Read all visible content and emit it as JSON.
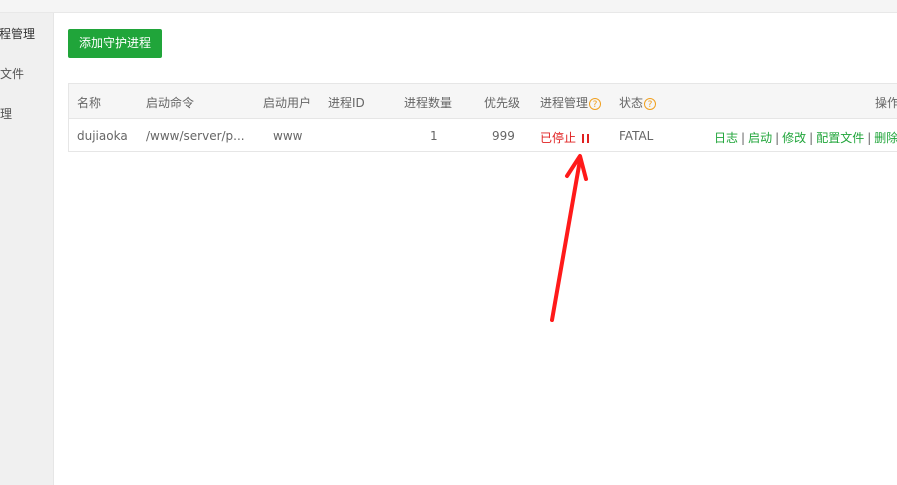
{
  "sidebar": {
    "items": [
      {
        "label": "程管理"
      },
      {
        "label": "文件"
      },
      {
        "label": "理"
      }
    ]
  },
  "toolbar": {
    "add_label": "添加守护进程"
  },
  "table": {
    "headers": {
      "name": "名称",
      "command": "启动命令",
      "user": "启动用户",
      "pid": "进程ID",
      "count": "进程数量",
      "priority": "优先级",
      "manage": "进程管理",
      "status": "状态",
      "actions": "操作"
    },
    "help_glyph": "?",
    "rows": [
      {
        "name": "dujiaoka",
        "command": "/www/server/p...",
        "user": "www",
        "pid": "",
        "count": "1",
        "priority": "999",
        "manage": "已停止",
        "status": "FATAL",
        "actions": [
          "日志",
          "启动",
          "修改",
          "配置文件",
          "删除"
        ]
      }
    ]
  },
  "colors": {
    "accent": "#20a53a",
    "danger": "#e02020",
    "help": "#f0a020",
    "annotation_arrow": "#ff1a1a"
  }
}
